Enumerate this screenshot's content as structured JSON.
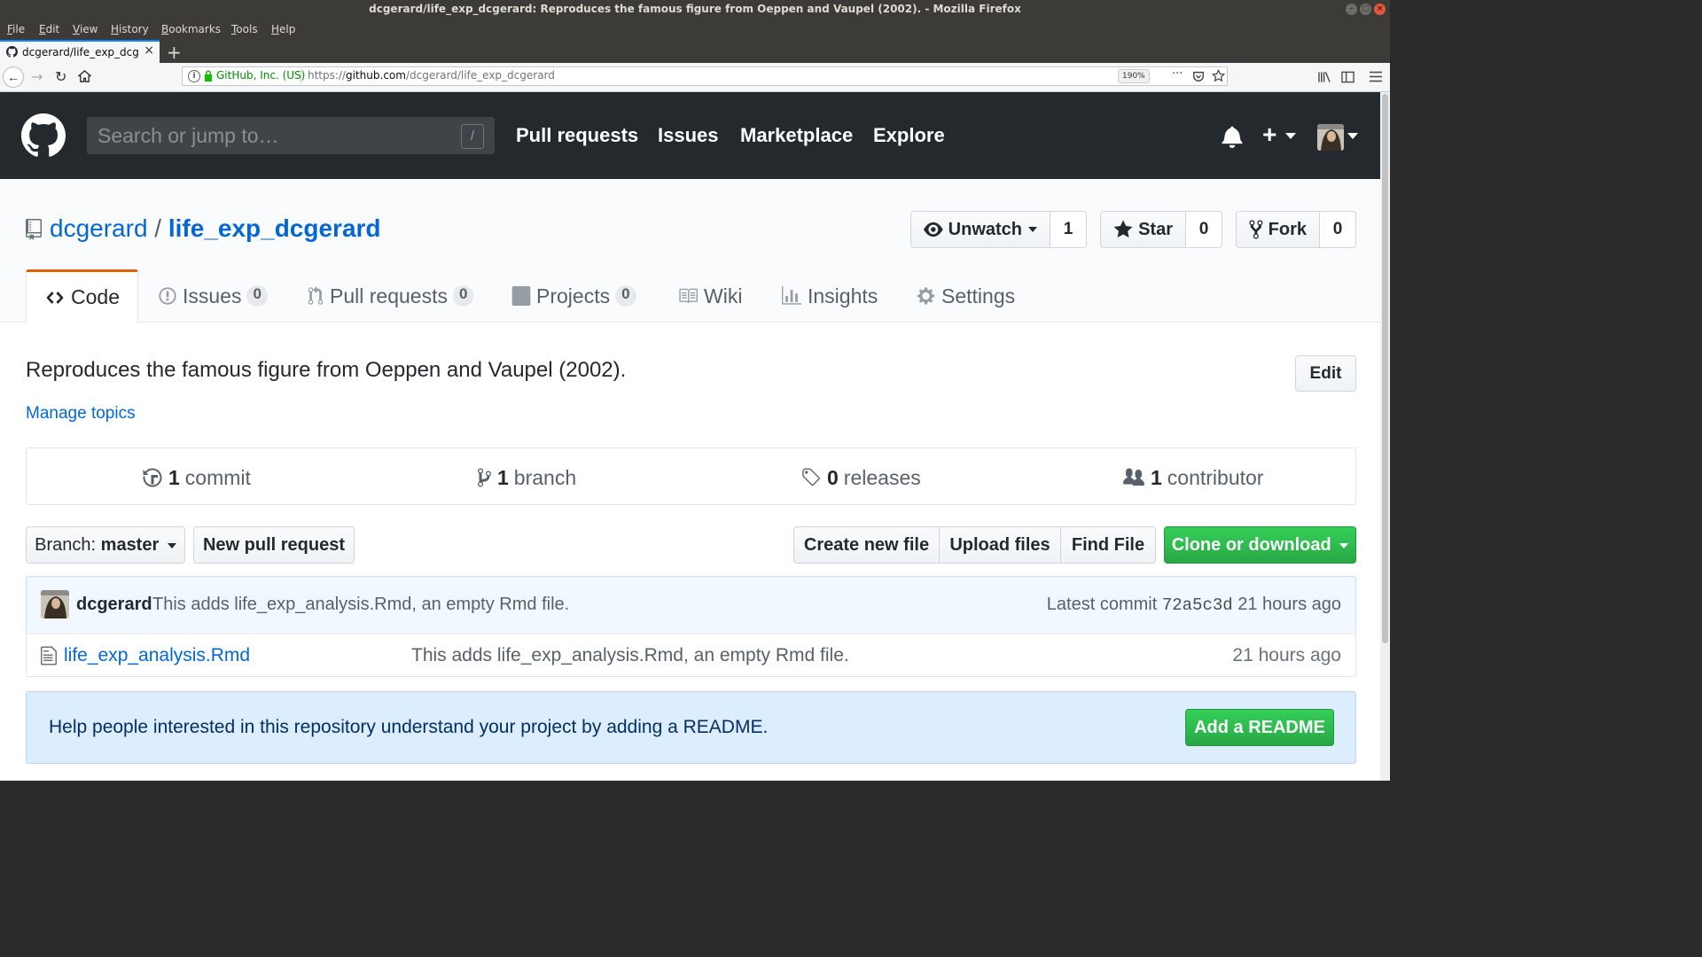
{
  "window": {
    "title": "dcgerard/life_exp_dcgerard: Reproduces the famous figure from Oeppen and Vaupel (2002). - Mozilla Firefox"
  },
  "menubar": [
    "File",
    "Edit",
    "View",
    "History",
    "Bookmarks",
    "Tools",
    "Help"
  ],
  "browser_tab": {
    "title": "dcgerard/life_exp_dcgerard",
    "close": "×",
    "new_tab": "+"
  },
  "navbar": {
    "site_identity": "GitHub, Inc. (US)",
    "url_prefix": "https://",
    "url_domain": "github.com",
    "url_path": "/dcgerard/life_exp_dcgerard",
    "zoom": "190%",
    "more": "···"
  },
  "header": {
    "search_placeholder": "Search or jump to…",
    "search_shortcut": "/",
    "nav": [
      "Pull requests",
      "Issues",
      "Marketplace",
      "Explore"
    ],
    "plus": "+"
  },
  "repo": {
    "owner": "dcgerard",
    "separator": "/",
    "name": "life_exp_dcgerard",
    "watch_label": "Unwatch",
    "watch_count": "1",
    "star_label": "Star",
    "star_count": "0",
    "fork_label": "Fork",
    "fork_count": "0",
    "tabs": [
      {
        "label": "Code",
        "count": ""
      },
      {
        "label": "Issues",
        "count": "0"
      },
      {
        "label": "Pull requests",
        "count": "0"
      },
      {
        "label": "Projects",
        "count": "0"
      },
      {
        "label": "Wiki",
        "count": ""
      },
      {
        "label": "Insights",
        "count": ""
      },
      {
        "label": "Settings",
        "count": ""
      }
    ]
  },
  "main": {
    "description": "Reproduces the famous figure from Oeppen and Vaupel (2002).",
    "edit_label": "Edit",
    "manage_topics": "Manage topics",
    "numbers": [
      {
        "count": "1",
        "label": "commit"
      },
      {
        "count": "1",
        "label": "branch"
      },
      {
        "count": "0",
        "label": "releases"
      },
      {
        "count": "1",
        "label": "contributor"
      }
    ],
    "branch_prefix": "Branch:",
    "branch_name": "master",
    "new_pull_request": "New pull request",
    "create_new_file": "Create new file",
    "upload_files": "Upload files",
    "find_file": "Find File",
    "clone_or_download": "Clone or download"
  },
  "commit": {
    "author": "dcgerard",
    "message": "This adds life_exp_analysis.Rmd, an empty Rmd file.",
    "latest_label": "Latest commit",
    "sha": "72a5c3d",
    "age": "21 hours ago"
  },
  "files": [
    {
      "name": "life_exp_analysis.Rmd",
      "message": "This adds life_exp_analysis.Rmd, an empty Rmd file.",
      "age": "21 hours ago"
    }
  ],
  "readme": {
    "prompt": "Help people interested in this repository understand your project by adding a README.",
    "button": "Add a README"
  },
  "colors": {
    "header_bg": "#24292e",
    "link": "#0366d6",
    "green": "#28a745",
    "tab_accent": "#e36209",
    "readme_bg": "#dbedff"
  },
  "icons": [
    "github-logo-icon",
    "bell-icon",
    "repo-icon",
    "eye-icon",
    "star-icon",
    "fork-icon",
    "code-icon",
    "issue-icon",
    "pull-request-icon",
    "project-icon",
    "wiki-icon",
    "graph-icon",
    "gear-icon",
    "history-icon",
    "branch-icon",
    "tag-icon",
    "people-icon",
    "file-icon"
  ]
}
